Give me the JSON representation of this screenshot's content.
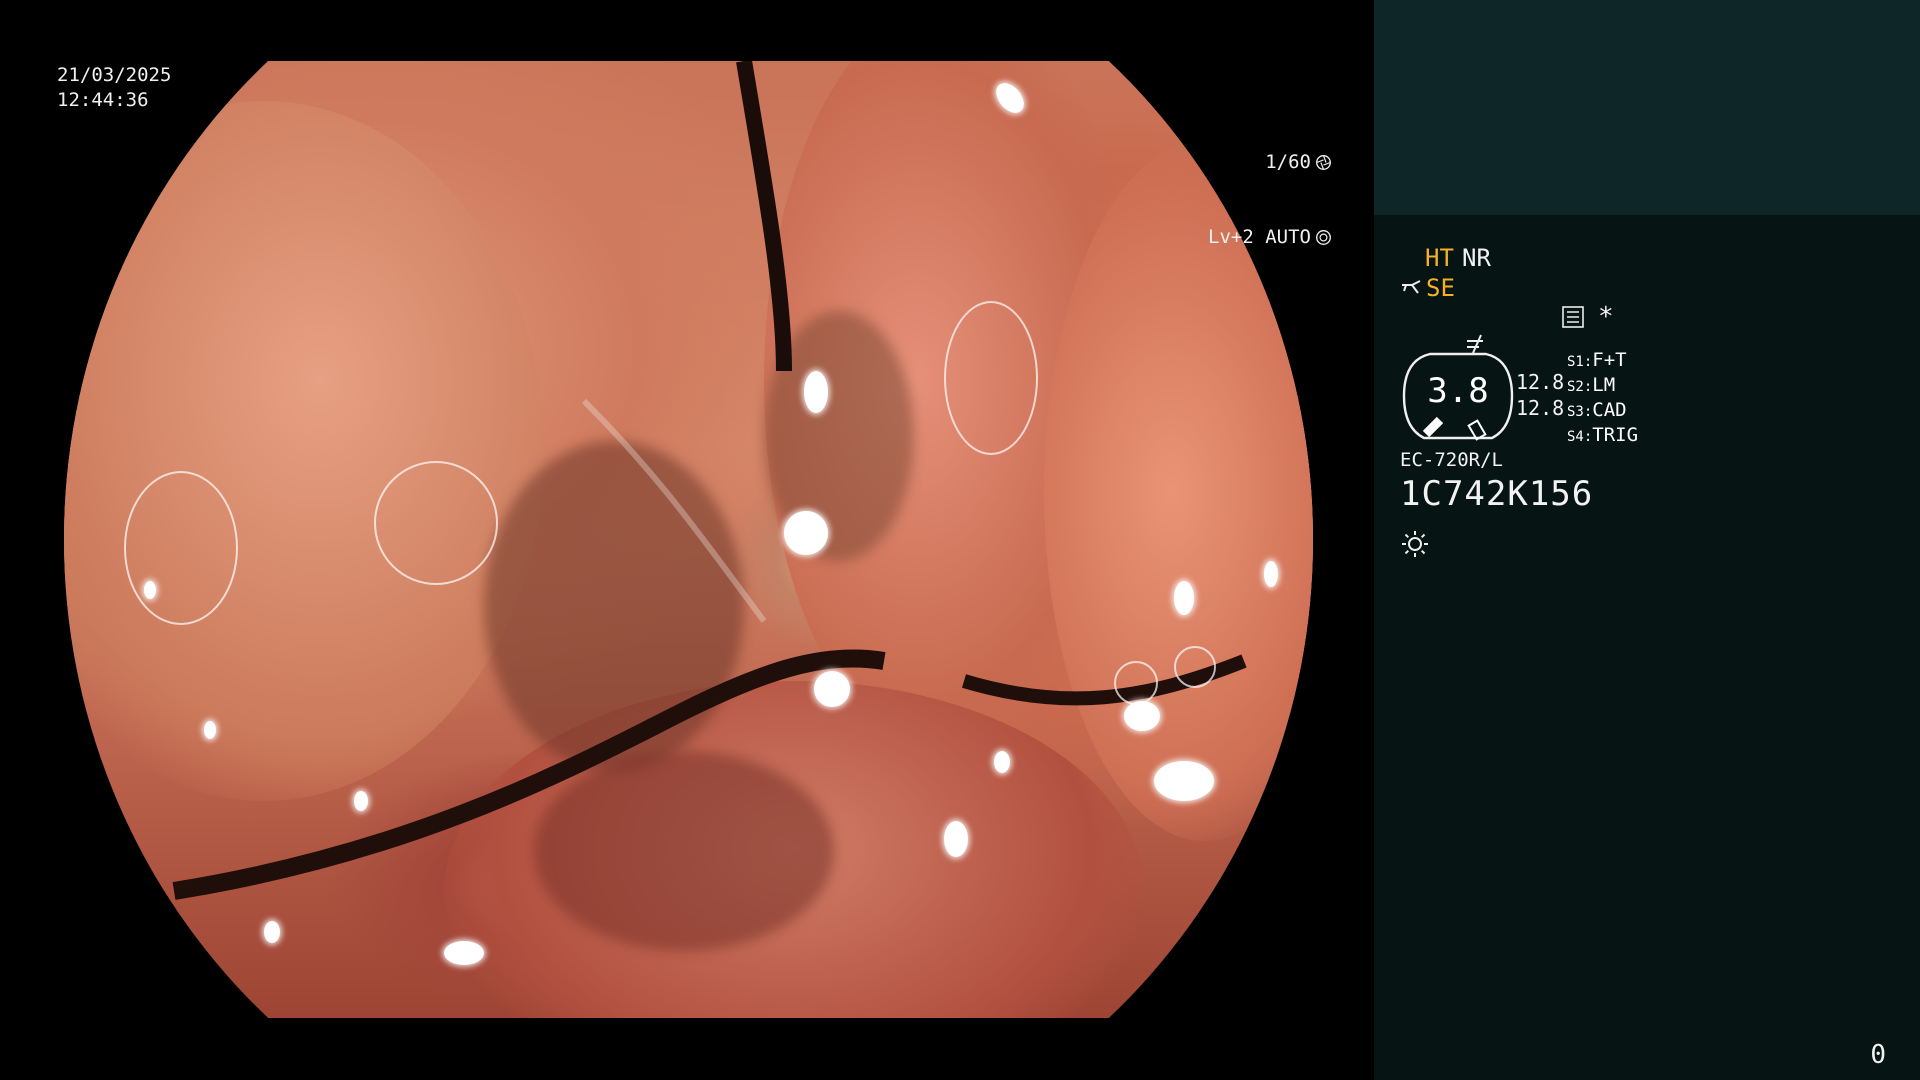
{
  "video": {
    "date": "21/03/2025",
    "time": "12:44:36",
    "shutter": "1/60",
    "shutter_icon": "aperture-icon",
    "level": "Lv+2 AUTO",
    "level_icon": "iris-icon"
  },
  "panel": {
    "mode_ht": "HT",
    "mode_nr": "NR",
    "se_label": "SE",
    "se_icon": "scope-tip-icon",
    "function_icon": "not-equal-icon",
    "menu_icon": "menu-list-icon",
    "star": "*",
    "gauge_value": "3.8",
    "gauge_side_1": "12.8",
    "gauge_side_2": "12.8",
    "switches": [
      {
        "key": "S1:",
        "value": "F+T"
      },
      {
        "key": "S2:",
        "value": "LM"
      },
      {
        "key": "S3:",
        "value": "CAD"
      },
      {
        "key": "S4:",
        "value": "TRIG"
      }
    ],
    "model": "EC-720R/L",
    "serial": "1C742K156",
    "light_icon": "sun-icon",
    "page_number": "0"
  },
  "colors": {
    "accent_yellow": "#f5b027",
    "panel_bg": "#061413",
    "panel_top_bg": "#0e2627"
  }
}
